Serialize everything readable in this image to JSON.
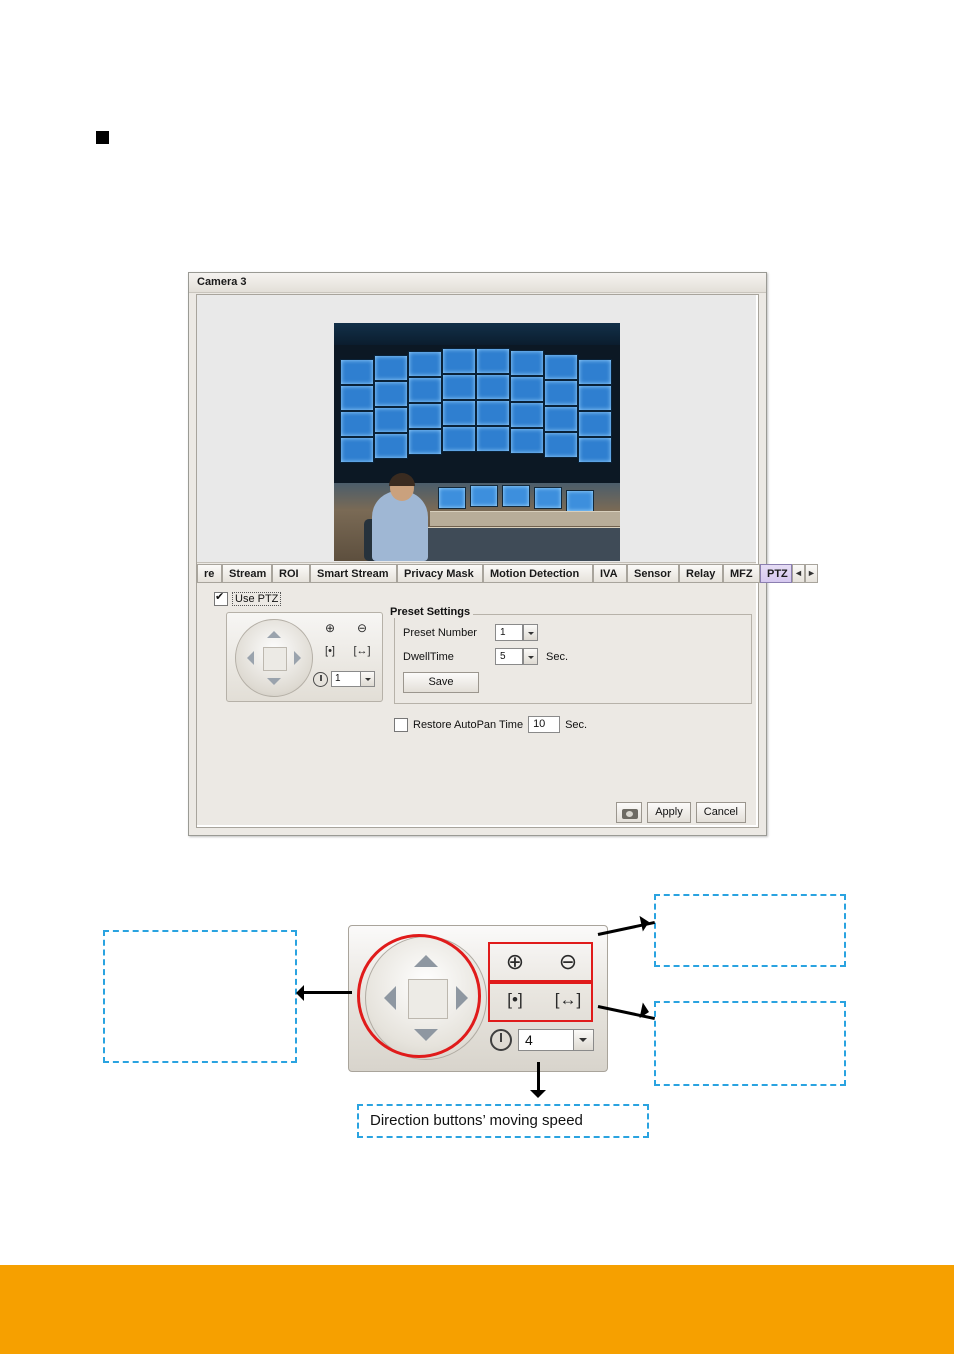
{
  "page": {
    "bullet_marker": "■"
  },
  "dialog": {
    "title": "Camera 3",
    "tabs": [
      {
        "label": "re",
        "selected": false
      },
      {
        "label": "Stream",
        "selected": false
      },
      {
        "label": "ROI",
        "selected": false
      },
      {
        "label": "Smart Stream",
        "selected": false
      },
      {
        "label": "Privacy Mask",
        "selected": false
      },
      {
        "label": "Motion Detection",
        "selected": false
      },
      {
        "label": "IVA",
        "selected": false
      },
      {
        "label": "Sensor",
        "selected": false
      },
      {
        "label": "Relay",
        "selected": false
      },
      {
        "label": "MFZ",
        "selected": false
      },
      {
        "label": "PTZ",
        "selected": true
      }
    ],
    "tab_scroll_left": "◄",
    "tab_scroll_right": "►",
    "use_ptz": {
      "label": "Use PTZ",
      "checked": true
    },
    "ptz_pad": {
      "zoom_in_icon": "⊕",
      "zoom_out_icon": "⊖",
      "focus_near_icon": "[•]",
      "focus_far_icon": "[↔]",
      "speed_value": "1"
    },
    "preset": {
      "group_title": "Preset Settings",
      "preset_number_label": "Preset Number",
      "preset_number_value": "1",
      "dwell_time_label": "DwellTime",
      "dwell_time_value": "5",
      "dwell_time_unit": "Sec.",
      "save_label": "Save"
    },
    "autopan": {
      "label": "Restore AutoPan Time",
      "checked": false,
      "value": "10",
      "unit": "Sec."
    },
    "footer": {
      "snapshot_icon": "camera-icon",
      "apply_label": "Apply",
      "cancel_label": "Cancel"
    }
  },
  "diagram": {
    "pad": {
      "zoom_in_icon": "⊕",
      "zoom_out_icon": "⊖",
      "focus_near_icon": "[•]",
      "focus_far_icon": "[↔]",
      "speed_value": "4"
    },
    "callouts": {
      "left": "",
      "top_right": "",
      "bottom_right": "",
      "bottom": "Direction buttons’ moving speed"
    }
  },
  "colors": {
    "callout_border": "#2aa3e0",
    "highlight_red": "#e01b1b",
    "tab_selected": "#d6c8ef",
    "band": "#f6a000"
  }
}
